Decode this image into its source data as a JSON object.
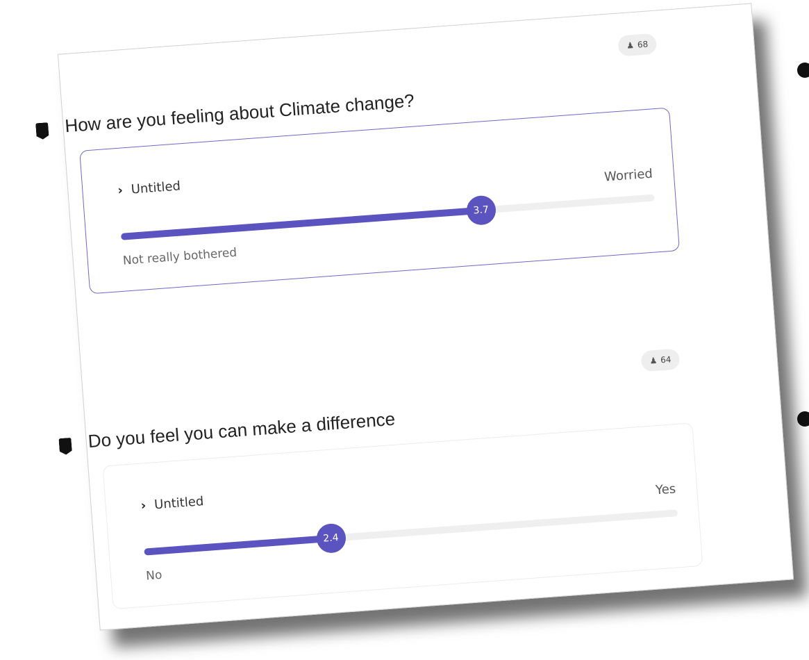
{
  "questions": [
    {
      "title": "How are you feeling about Climate change?",
      "response_count": "68",
      "item_label": "Untitled",
      "value": 3.7,
      "value_label": "3.7",
      "scale_min": 1,
      "scale_max": 5,
      "low_label": "Not really bothered",
      "high_label": "Worried"
    },
    {
      "title": "Do you feel you can make a difference",
      "response_count": "64",
      "item_label": "Untitled",
      "value": 2.4,
      "value_label": "2.4",
      "scale_min": 1,
      "scale_max": 5,
      "low_label": "No",
      "high_label": "Yes"
    }
  ],
  "icons": {
    "question": "shield-icon",
    "count": "person-icon",
    "expand": "chevron-right-icon"
  },
  "colors": {
    "accent": "#5b53bf",
    "track": "#efefef",
    "active_border": "#6e68c8"
  }
}
